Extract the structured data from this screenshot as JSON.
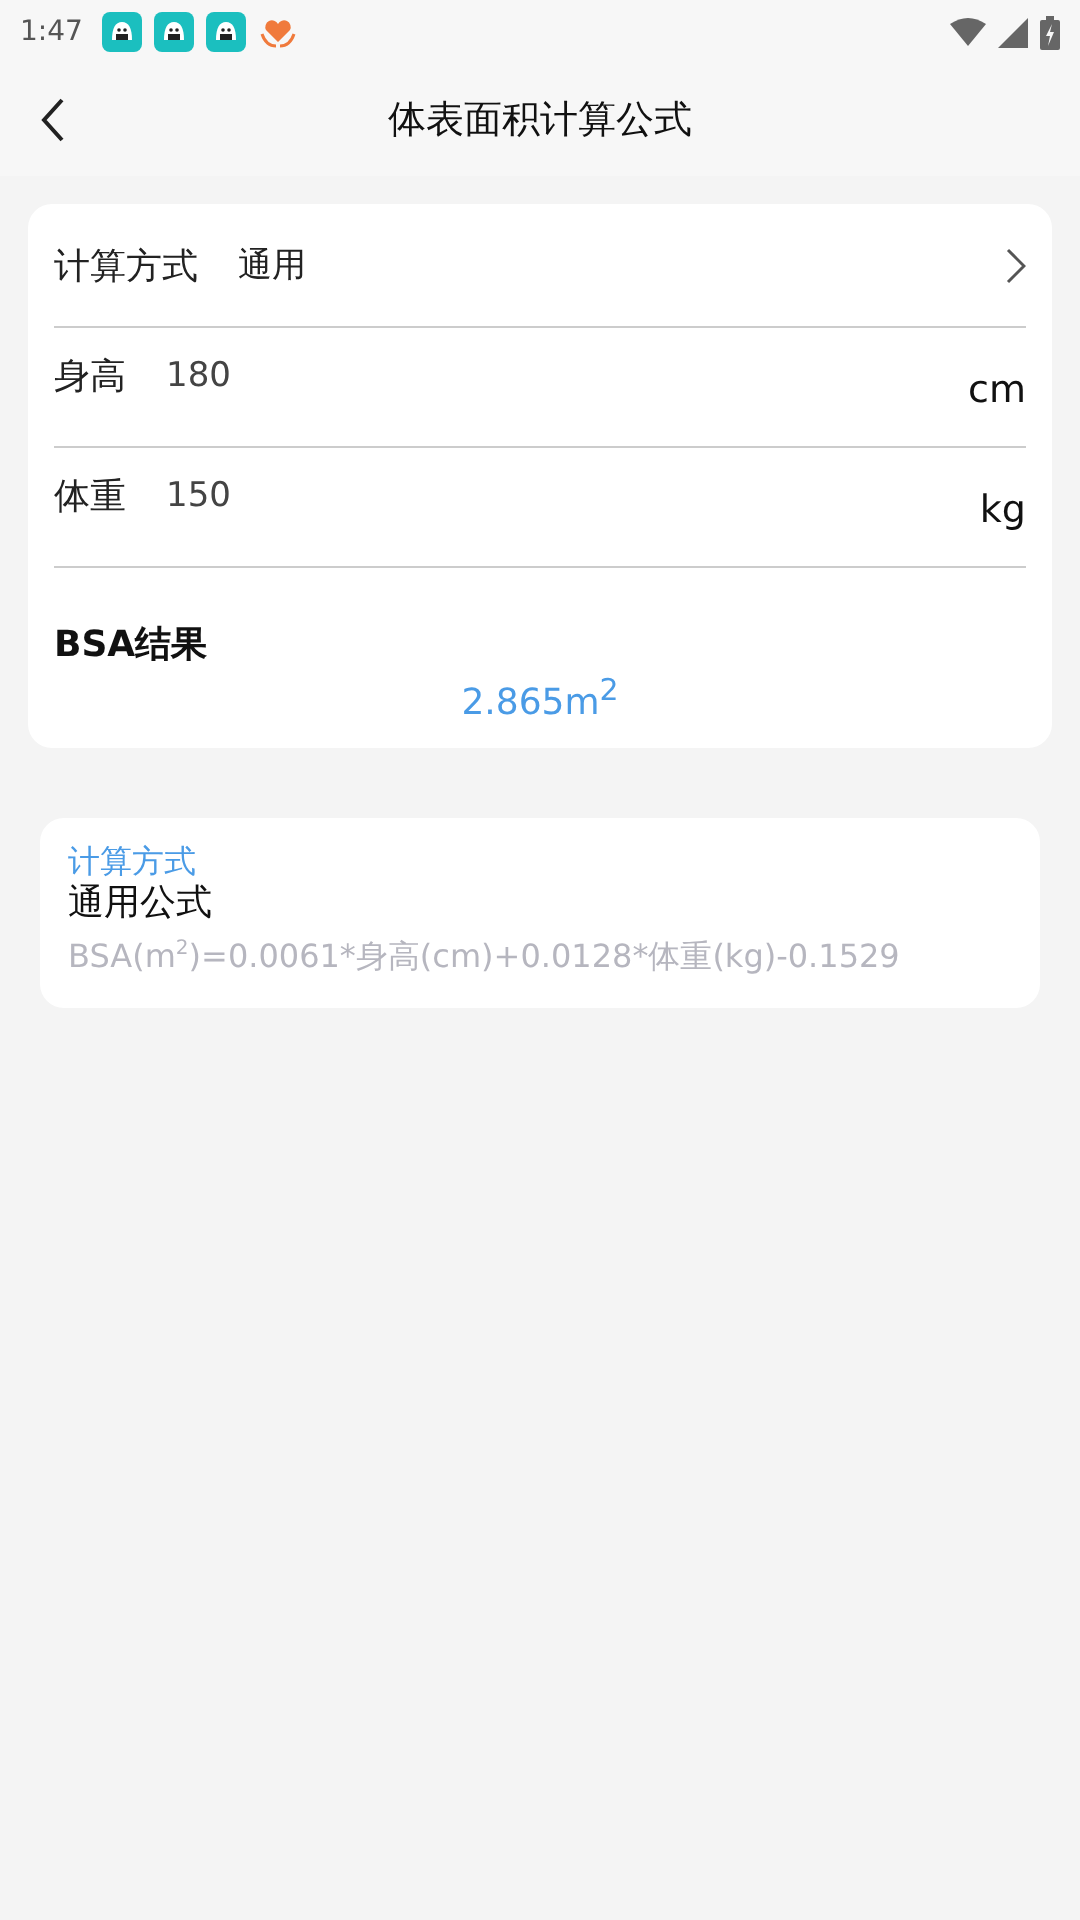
{
  "status_bar": {
    "time": "1:47"
  },
  "header": {
    "title": "体表面积计算公式"
  },
  "form": {
    "method": {
      "label": "计算方式",
      "value": "通用"
    },
    "fields": [
      {
        "label": "身高",
        "value": "180",
        "unit": "cm"
      },
      {
        "label": "体重",
        "value": "150",
        "unit": "kg"
      }
    ],
    "result": {
      "label": "BSA结果",
      "value": "2.865m$^{2}$"
    }
  },
  "formula_card": {
    "heading": "计算方式",
    "name": "通用公式",
    "formula": "BSA(m$^{2}$)=0.0061*身高(cm)+0.0128*体重(kg)-0.1529"
  }
}
